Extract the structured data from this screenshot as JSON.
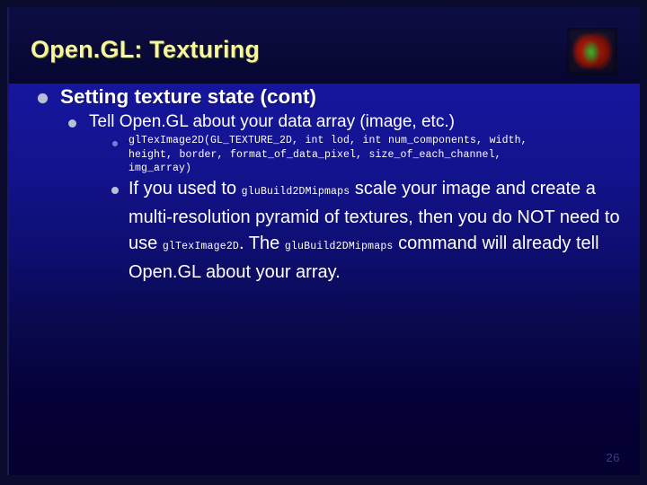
{
  "slide": {
    "title": "Open.GL: Texturing",
    "page_number": "26",
    "thumbnail_alt": "volume-rendering-thumbnail",
    "colors": {
      "title_text": "#f7f7a0",
      "body_text": "#ffffff",
      "title_band": "#0a0a3a",
      "body_background_top": "#16169e",
      "body_background_bottom": "#04002f",
      "bullet_level1": "#b9bfd4",
      "bullet_level2": "#b9bfd4",
      "bullet_level3": "#7a7ad0",
      "page_number": "#3b3b8e"
    },
    "outline": {
      "level1": {
        "text": "Setting texture state (cont)"
      },
      "level2": {
        "text": "Tell Open.GL about your data array (image, etc.)"
      },
      "code_bullet": {
        "line1": "glTexImage2D(GL_TEXTURE_2D, int lod, int num_components, width,",
        "line2": "height, border, format_of_data_pixel, size_of_each_channel,",
        "line3": "img_array)"
      },
      "paragraph_bullet": {
        "seg1": "If you used to ",
        "code1": "gluBuild2DMipmaps",
        "seg2": " scale your image and create a multi-resolution pyramid of textures, then you do NOT need to use ",
        "code2": "glTexImage2D",
        "seg3": ". The ",
        "code3": "gluBuild2DMipmaps",
        "seg4": " command will already tell Open.GL about your array."
      }
    }
  }
}
